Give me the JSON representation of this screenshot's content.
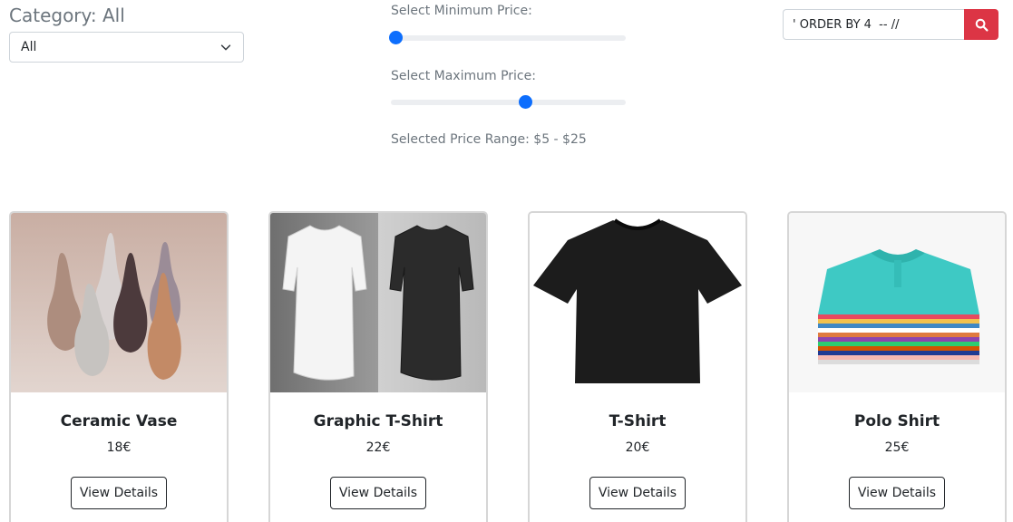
{
  "category": {
    "title": "Category: All",
    "selected": "All"
  },
  "price": {
    "min_label": "Select Minimum Price:",
    "max_label": "Select Maximum Price:",
    "min_fraction": 0.02,
    "max_fraction": 0.57,
    "range_text": "Selected Price Range: $5 - $25"
  },
  "search": {
    "value": "' ORDER BY 4  -- //",
    "icon": "search-icon",
    "button_color": "#dc3545"
  },
  "products": [
    {
      "name": "Ceramic Vase",
      "price": "18€",
      "button": "View Details",
      "image": "ceramic-vases"
    },
    {
      "name": "Graphic T-Shirt",
      "price": "22€",
      "button": "View Details",
      "image": "white-black-tshirts"
    },
    {
      "name": "T-Shirt",
      "price": "20€",
      "button": "View Details",
      "image": "black-tshirt"
    },
    {
      "name": "Polo Shirt",
      "price": "25€",
      "button": "View Details",
      "image": "stacked-polo-shirts"
    }
  ],
  "colors": {
    "accent": "#0d6efd",
    "muted_text": "#6c757d"
  }
}
